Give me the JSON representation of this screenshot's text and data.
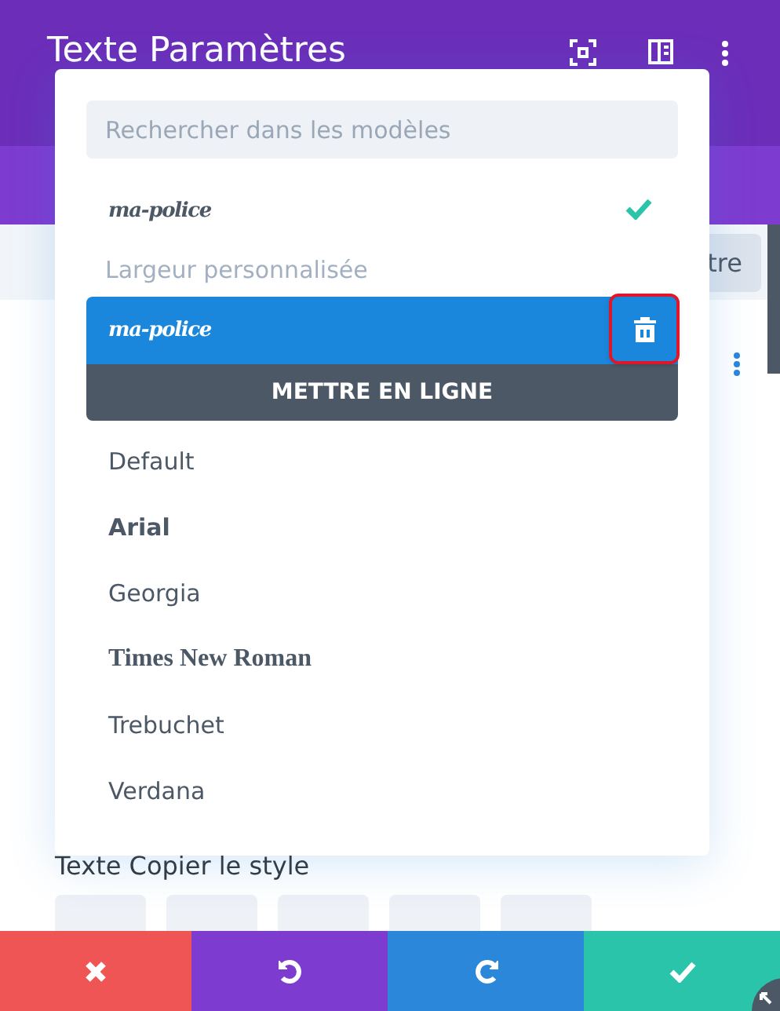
{
  "header": {
    "title": "Texte Paramètres"
  },
  "side_button": {
    "label": "tre"
  },
  "dropdown": {
    "search": {
      "placeholder": "Rechercher dans les modèles"
    },
    "recent": [
      {
        "label": "ma-police",
        "checked": true
      }
    ],
    "uploaded_heading": "Largeur personnalisée",
    "uploaded": [
      {
        "label": "ma-police",
        "selected": true
      }
    ],
    "upload_button": "METTRE EN LIGNE",
    "fonts": [
      {
        "label": "Default",
        "kind": "plain"
      },
      {
        "label": "Arial",
        "kind": "bold"
      },
      {
        "label": "Georgia",
        "kind": "plain"
      },
      {
        "label": "Times New Roman",
        "kind": "serif"
      },
      {
        "label": "Trebuchet",
        "kind": "plain"
      },
      {
        "label": "Verdana",
        "kind": "plain"
      }
    ]
  },
  "copy_style_label": "Texte Copier le style",
  "footer": [
    {
      "kind": "cancel"
    },
    {
      "kind": "undo"
    },
    {
      "kind": "redo"
    },
    {
      "kind": "save"
    }
  ]
}
